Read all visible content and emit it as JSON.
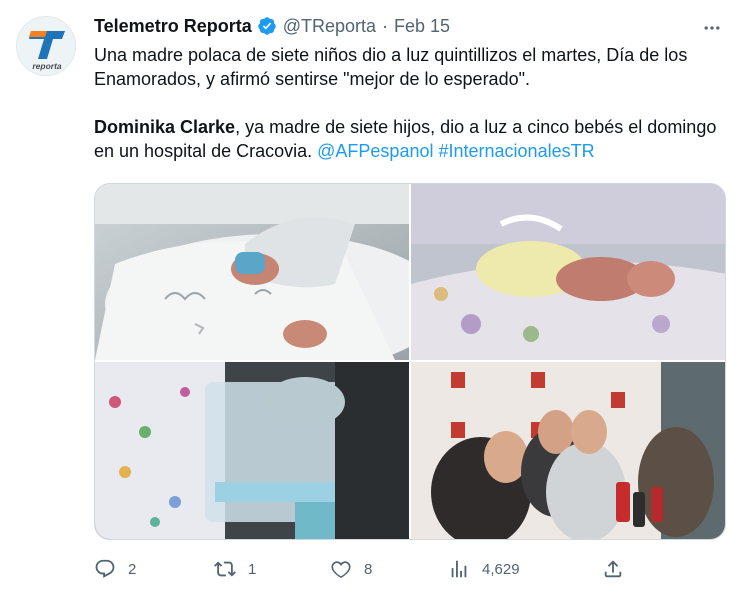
{
  "author": {
    "name": "Telemetro Reporta",
    "handle": "@TReporta",
    "separator": "·",
    "date": "Feb 15",
    "avatar_text": "reporta",
    "verified_color": "#1d9bf0"
  },
  "tweet": {
    "line1": "Una madre polaca de siete niños dio a luz quintillizos el martes, Día de los Enamorados, y afirmó sentirse \"mejor de lo esperado\".",
    "bold_name": "Dominika Clarke",
    "line2_rest": ", ya madre de siete hijos, dio a luz a cinco bebés el domingo en un hospital de Cracovia. ",
    "mention": "@AFPespanol",
    "hashtag": "#InternacionalesTR"
  },
  "media": {
    "images": [
      {
        "name": "newborn-feet-photo",
        "icon": "photo"
      },
      {
        "name": "incubator-baby-photo",
        "icon": "photo"
      },
      {
        "name": "nurse-incubator-photo",
        "icon": "photo"
      },
      {
        "name": "press-conference-photo",
        "icon": "photo"
      }
    ]
  },
  "actions": {
    "reply_count": "2",
    "retweet_count": "1",
    "like_count": "8",
    "views_count": "4,629"
  },
  "colors": {
    "link": "#1d9bf0",
    "muted": "#536471",
    "text": "#0f1419",
    "brand_orange": "#f5821f",
    "brand_blue": "#1f73b7"
  }
}
